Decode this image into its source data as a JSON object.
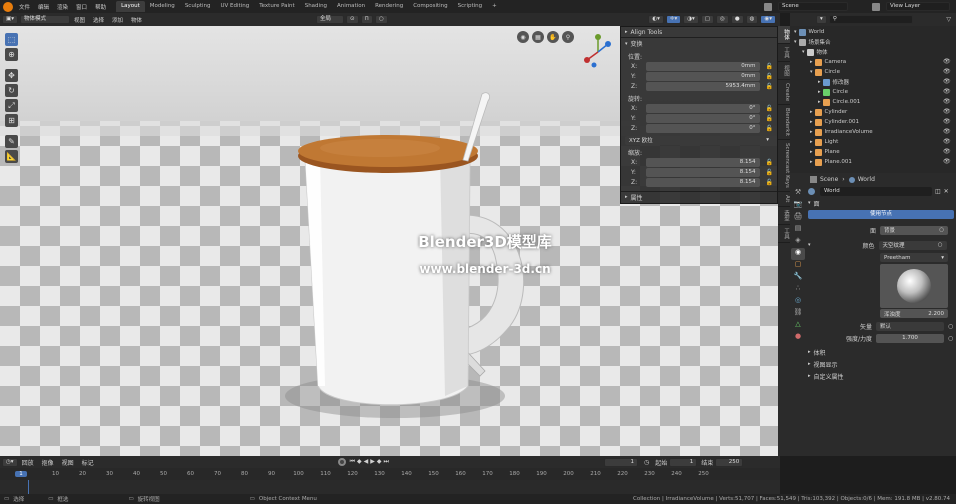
{
  "menu": [
    "文件",
    "编辑",
    "渲染",
    "窗口",
    "帮助"
  ],
  "workspaces": [
    "Layout",
    "Modeling",
    "Sculpting",
    "UV Editing",
    "Texture Paint",
    "Shading",
    "Animation",
    "Rendering",
    "Compositing",
    "Scripting"
  ],
  "scene": "Scene",
  "view_layer": "View Layer",
  "header": {
    "mode": "物体模式",
    "view": "视图",
    "select": "选择",
    "add": "添加",
    "object": "物体",
    "orientation": "全局"
  },
  "watermark": {
    "line1": "Blender3D模型库",
    "line2": "www.blender-3d.cn"
  },
  "npanel": {
    "align_tools": "Align Tools",
    "transform": "变换",
    "location_label": "位置:",
    "loc": [
      {
        "axis": "X:",
        "value": "0mm"
      },
      {
        "axis": "Y:",
        "value": "0mm"
      },
      {
        "axis": "Z:",
        "value": "5953.4mm"
      }
    ],
    "rotation_label": "旋转:",
    "rot": [
      {
        "axis": "X:",
        "value": "0°"
      },
      {
        "axis": "Y:",
        "value": "0°"
      },
      {
        "axis": "Z:",
        "value": "0°"
      }
    ],
    "rot_mode": "XYZ 欧拉",
    "scale_label": "缩放:",
    "scale": [
      {
        "axis": "X:",
        "value": "8.154"
      },
      {
        "axis": "Y:",
        "value": "8.154"
      },
      {
        "axis": "Z:",
        "value": "8.154"
      }
    ],
    "properties": "属性"
  },
  "side_tabs": [
    "物体",
    "工具",
    "视图",
    "Create",
    "Blenderkit",
    "Screencast Keys",
    "Ait",
    "造型",
    "工具"
  ],
  "outliner": {
    "rows": [
      {
        "name": "World",
        "indent": 0
      },
      {
        "name": "场景集合",
        "indent": 0
      },
      {
        "name": "物体",
        "indent": 1
      },
      {
        "name": "Camera",
        "indent": 2
      },
      {
        "name": "Circle",
        "indent": 2
      },
      {
        "name": "修改器",
        "indent": 3
      },
      {
        "name": "Circle",
        "indent": 3
      },
      {
        "name": "Circle.001",
        "indent": 3
      },
      {
        "name": "Cylinder",
        "indent": 2
      },
      {
        "name": "Cylinder.001",
        "indent": 2
      },
      {
        "name": "IrradianceVolume",
        "indent": 2
      },
      {
        "name": "Light",
        "indent": 2
      },
      {
        "name": "Plane",
        "indent": 2
      },
      {
        "name": "Plane.001",
        "indent": 2
      }
    ]
  },
  "props": {
    "breadcrumb_scene": "Scene",
    "breadcrumb_world": "World",
    "world_name": "World",
    "surface": "面",
    "use_nodes": "使用节点",
    "surface_label": "面",
    "surface_value": "背景",
    "color_label": "颜色",
    "color_value": "天空纹理",
    "sky_type": "Preetham",
    "turbidity": "浑浊度",
    "turbidity_value": "2.200",
    "vector_label": "矢量",
    "vector_value": "默认",
    "strength_label": "强度/力度",
    "strength_value": "1.700",
    "sections": [
      "体积",
      "视图显示",
      "自定义属性"
    ]
  },
  "timeline": {
    "menus": [
      "回放",
      "抠像",
      "视图",
      "标记"
    ],
    "current_frame": "1",
    "start_label": "起始",
    "start": "1",
    "end_label": "结束",
    "end": "250",
    "ticks": [
      "1",
      "10",
      "20",
      "30",
      "40",
      "50",
      "60",
      "70",
      "80",
      "90",
      "100",
      "110",
      "120",
      "130",
      "140",
      "150",
      "160",
      "170",
      "180",
      "190",
      "200",
      "210",
      "220",
      "230",
      "240",
      "250"
    ]
  },
  "status": {
    "select": "选择",
    "box_select": "框选",
    "rotate_view": "旋转视图",
    "context_menu": "Object Context Menu",
    "info": "Collection | IrradianceVolume | Verts:51,707 | Faces:51,549 | Tris:103,392 | Objects:0/6 | Mem: 191.8 MB | v2.80.74"
  },
  "colors": {
    "accent": "#4772b3",
    "lid": "#b06a2c",
    "header": "#2b2b2b"
  }
}
